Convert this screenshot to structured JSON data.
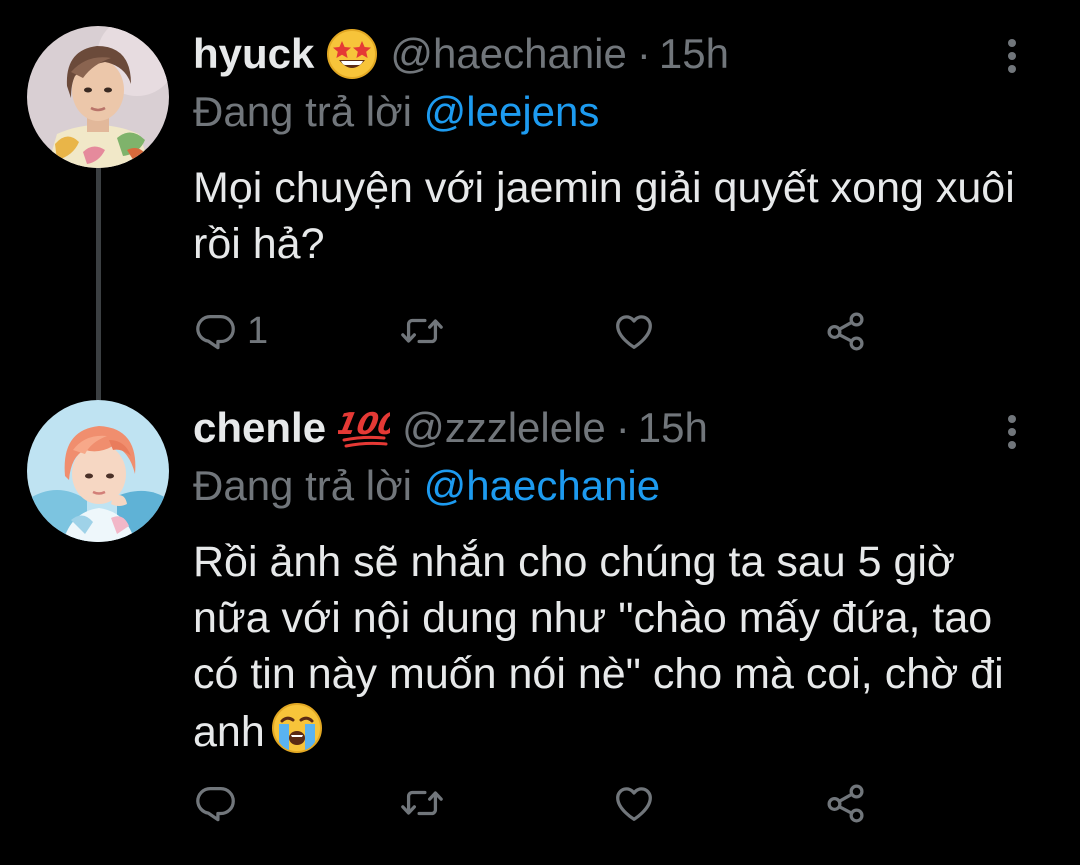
{
  "tweets": [
    {
      "display_name": "hyuck",
      "name_emoji": "star-struck-emoji",
      "handle": "@haechanie",
      "separator": "·",
      "time": "15h",
      "reply_prefix": "Đang trả lời",
      "reply_to": "@leejens",
      "text": "Mọi chuyện với jaemin giải quyết xong xuôi rồi hả?",
      "reply_count": "1",
      "avatar": "hyuck-avatar"
    },
    {
      "display_name": "chenle",
      "name_emoji": "hundred-points-emoji",
      "handle": "@zzzlelele",
      "separator": "·",
      "time": "15h",
      "reply_prefix": "Đang trả lời",
      "reply_to": "@haechanie",
      "text": "Rồi ảnh sẽ nhắn cho chúng ta sau 5 giờ nữa với nội dung như \"chào mấy đứa, tao có tin này muốn nói nè\" cho mà coi, chờ đi anh",
      "text_emoji": "loudly-crying-emoji",
      "reply_count": "",
      "avatar": "chenle-avatar"
    }
  ],
  "colors": {
    "background": "#000000",
    "text": "#e7e9ea",
    "secondary": "#71767b",
    "accent": "#1d9bf0",
    "thread_line": "#3b3f42"
  },
  "icons": [
    "reply-icon",
    "retweet-icon",
    "like-icon",
    "share-icon",
    "more-options-icon"
  ]
}
